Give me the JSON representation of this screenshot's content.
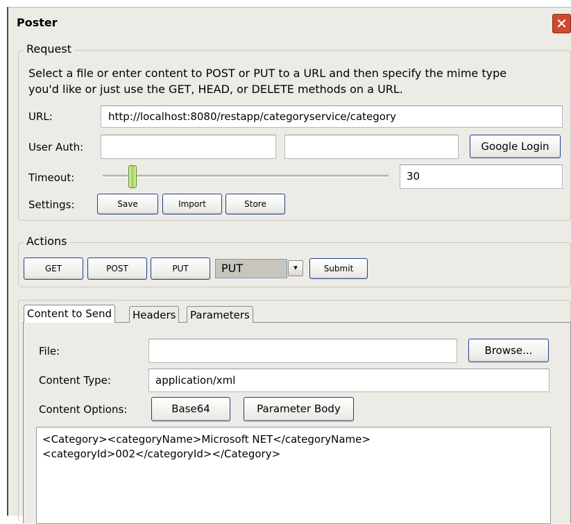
{
  "window": {
    "title": "Poster",
    "close_glyph": "✕"
  },
  "request": {
    "legend": "Request",
    "description_line1": "Select a file or enter content to POST or PUT to a URL and then specify the mime type",
    "description_line2": "you'd like or just use the GET, HEAD, or DELETE methods on a URL.",
    "url_label": "URL:",
    "url_value": "http://localhost:8080/restapp/categoryservice/category",
    "user_auth_label": "User Auth:",
    "user_value": "",
    "password_value": "",
    "google_login_label": "Google Login",
    "timeout_label": "Timeout:",
    "timeout_value": "30",
    "timeout_slider_fraction": 0.09,
    "settings_label": "Settings:",
    "save_label": "Save",
    "import_label": "Import",
    "store_label": "Store"
  },
  "actions": {
    "legend": "Actions",
    "get_label": "GET",
    "post_label": "POST",
    "put_label": "PUT",
    "method_selected": "PUT",
    "submit_label": "Submit"
  },
  "tabs": [
    {
      "label": "Content to Send",
      "active": true
    },
    {
      "label": "Headers",
      "active": false
    },
    {
      "label": "Parameters",
      "active": false
    }
  ],
  "content": {
    "file_label": "File:",
    "file_value": "",
    "browse_label": "Browse...",
    "content_type_label": "Content Type:",
    "content_type_value": "application/xml",
    "content_options_label": "Content Options:",
    "base64_label": "Base64",
    "parameter_body_label": "Parameter Body",
    "body_line1": "<Category><categoryName>Microsoft NET</categoryName>",
    "body_line2": "<categoryId>002</categoryId></Category>"
  }
}
